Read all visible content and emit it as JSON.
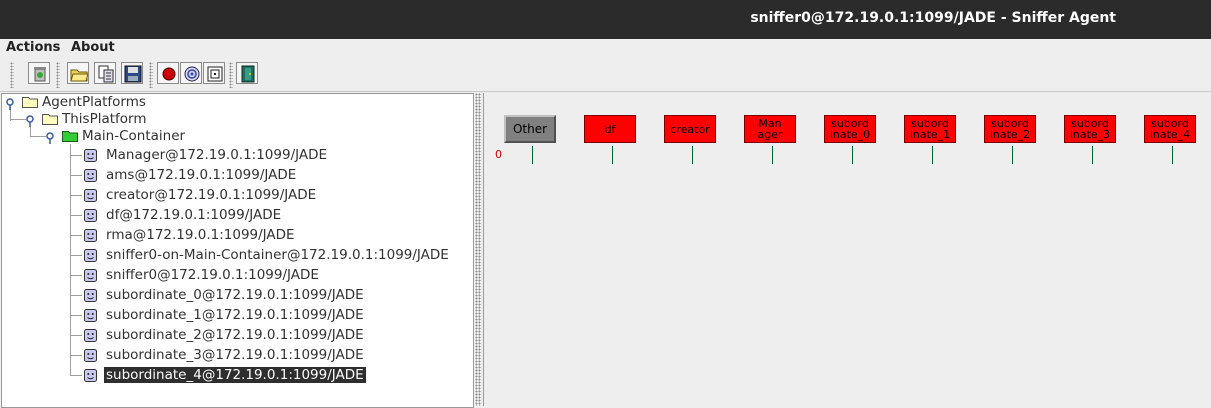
{
  "window": {
    "title": "sniffer0@172.19.0.1:1099/JADE - Sniffer Agent"
  },
  "menu": {
    "items": [
      "Actions",
      "About"
    ]
  },
  "toolbar": {
    "buttons": [
      "clear-canvas",
      "open-file",
      "write-messages",
      "save",
      "select-agent",
      "unselect-agent",
      "show-only",
      "exit"
    ]
  },
  "tree": {
    "root": "AgentPlatforms",
    "platform": "ThisPlatform",
    "container": "Main-Container",
    "agents": [
      "Manager@172.19.0.1:1099/JADE",
      "ams@172.19.0.1:1099/JADE",
      "creator@172.19.0.1:1099/JADE",
      "df@172.19.0.1:1099/JADE",
      "rma@172.19.0.1:1099/JADE",
      "sniffer0-on-Main-Container@172.19.0.1:1099/JADE",
      "sniffer0@172.19.0.1:1099/JADE",
      "subordinate_0@172.19.0.1:1099/JADE",
      "subordinate_1@172.19.0.1:1099/JADE",
      "subordinate_2@172.19.0.1:1099/JADE",
      "subordinate_3@172.19.0.1:1099/JADE",
      "subordinate_4@172.19.0.1:1099/JADE"
    ],
    "selected_index": 11
  },
  "canvas": {
    "time_label": "0",
    "agents": [
      {
        "label": "Other",
        "kind": "other"
      },
      {
        "label": "df",
        "kind": "agent"
      },
      {
        "label": "creator",
        "kind": "agent"
      },
      {
        "label": "Man\nager",
        "kind": "agent"
      },
      {
        "label": "subord\ninate_0",
        "kind": "agent"
      },
      {
        "label": "subord\ninate_1",
        "kind": "agent"
      },
      {
        "label": "subord\ninate_2",
        "kind": "agent"
      },
      {
        "label": "subord\ninate_3",
        "kind": "agent"
      },
      {
        "label": "subord\ninate_4",
        "kind": "agent"
      }
    ]
  },
  "colors": {
    "agent_box": "#ff0000",
    "other_box": "#808080",
    "lifeline": "#006633",
    "selection": "#2e2e2e"
  }
}
